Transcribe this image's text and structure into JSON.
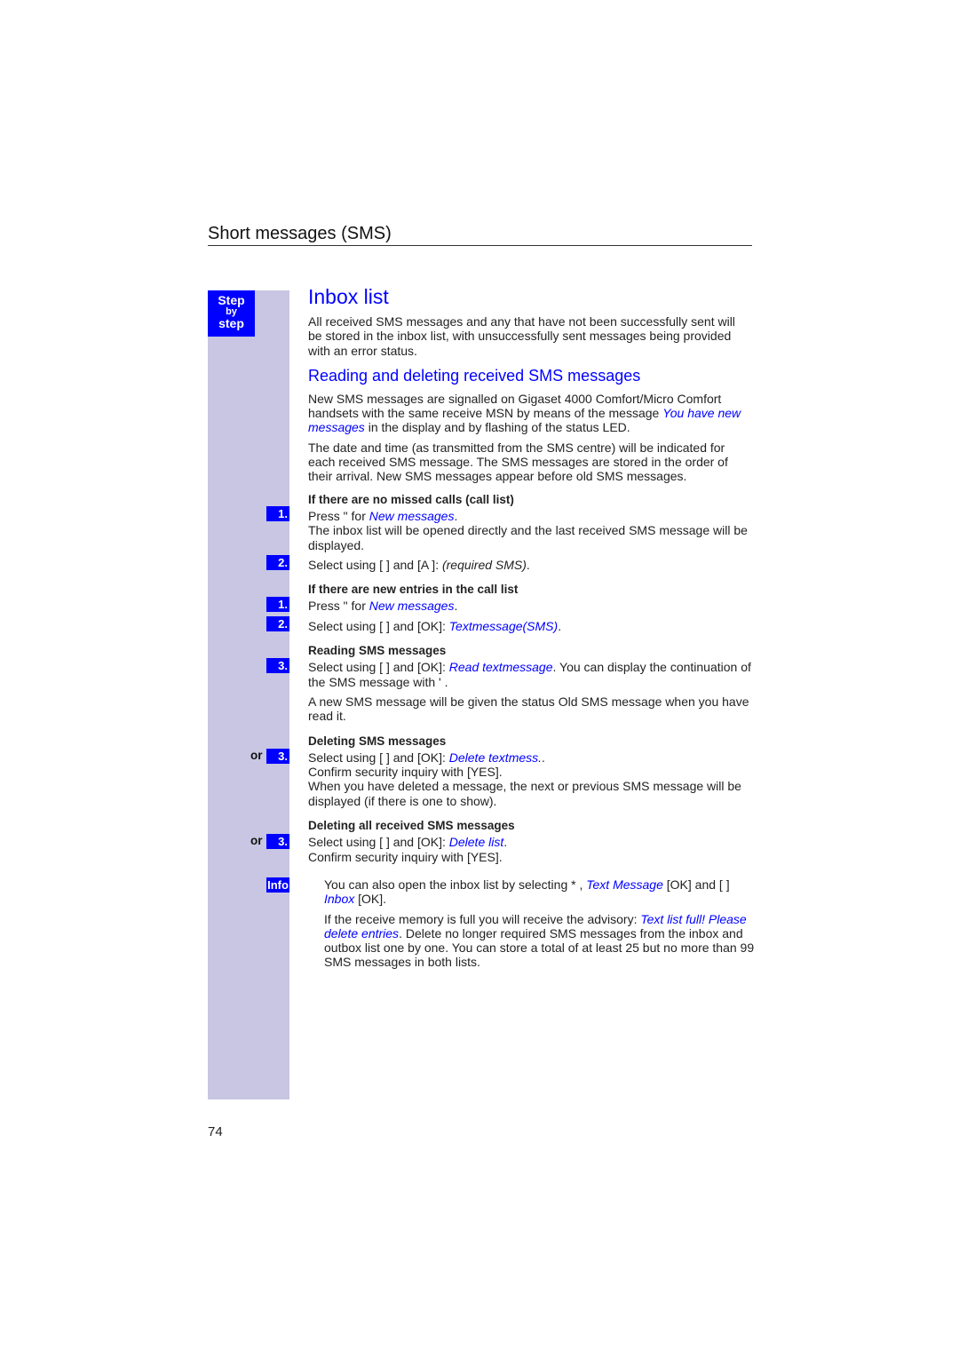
{
  "chapter_title": "Short messages (SMS)",
  "step_badge": {
    "line1": "Step",
    "line2": "by",
    "line3": "step"
  },
  "section_title": "Inbox list",
  "intro": "All received SMS messages and any that have not been successfully sent will be stored in the inbox list, with unsuccessfully sent messages being provided with an error status.",
  "subsection_title": "Reading and deleting received SMS messages",
  "para1": {
    "before": "New SMS messages are signalled on Gigaset 4000 Comfort/Micro Comfort handsets with the same receive MSN by means of the message ",
    "highlight": "You have new messages",
    "after": " in the display and by flashing of the status LED."
  },
  "para2": "The date and time (as transmitted from the SMS centre) will be indicated for each received SMS message. The SMS messages are stored in the order of their arrival. New SMS messages appear before old SMS messages.",
  "block_no_missed": {
    "heading": "If there are  no missed calls (call list)",
    "step1": {
      "num": "1.",
      "before": "Press \"     for ",
      "highlight": "New messages",
      "after": ".",
      "note": "The inbox list will be opened directly and the last received SMS message will be displayed."
    },
    "step2": {
      "num": "2.",
      "before": "Select using [   ] and [A   ]: ",
      "italic": "(required SMS)",
      "after": "."
    }
  },
  "block_new_entries": {
    "heading": "If there are new entries in the call list",
    "step1": {
      "num": "1.",
      "before": "Press \"     for ",
      "highlight": "New messages",
      "after": "."
    },
    "step2": {
      "num": "2.",
      "before": "Select using [   ] and [OK]: ",
      "highlight": "Textmessage(SMS)",
      "after": "."
    }
  },
  "block_reading": {
    "heading": "Reading SMS messages",
    "step3": {
      "num": "3.",
      "before": "Select using [   ] and [OK]: ",
      "highlight": "Read textmessage",
      "after": ". You can display the continuation of the SMS message with '     ."
    },
    "note": "A new SMS message will be given the status   Old SMS message   when you have read it."
  },
  "block_deleting": {
    "heading": "Deleting SMS messages",
    "or_label": "or",
    "step3": {
      "num": "3.",
      "before": "Select using [   ] and [OK]: ",
      "highlight": "Delete textmess.",
      "after": ".",
      "line2": "Confirm security inquiry with [YES].",
      "line3": "When you have deleted a message, the next or previous SMS message will be displayed (if there is one to show)."
    }
  },
  "block_deleting_all": {
    "heading": "Deleting all received SMS messages",
    "or_label": "or",
    "step3": {
      "num": "3.",
      "before": "Select using [   ] and [OK]: ",
      "highlight": "Delete list",
      "after": ".",
      "line2": "Confirm security inquiry with [YES]."
    }
  },
  "info": {
    "label": "Info",
    "p1": {
      "before": "You can also open the inbox list by selecting *     , ",
      "hl1": "Text Message",
      "mid": " [OK] and [   ] ",
      "hl2": "Inbox",
      "after": " [OK]."
    },
    "p2": {
      "before": "If the receive memory is full you will receive the advisory: ",
      "highlight": "Text list full! Please delete entries",
      "after": ". Delete no longer required SMS messages from the inbox and outbox list one by one. You can store a total of at least 25 but no more than 99 SMS messages in both lists."
    }
  },
  "page_number": "74"
}
